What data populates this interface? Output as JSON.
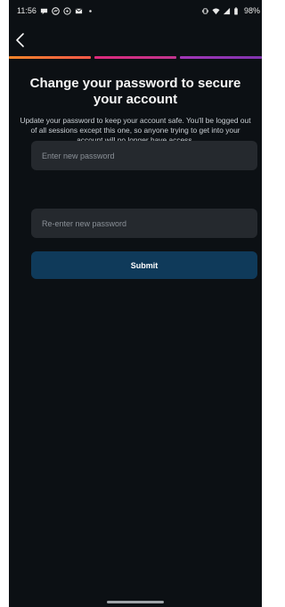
{
  "status_bar": {
    "time": "11:56",
    "battery": "98%",
    "left_icons": [
      "chat-bubble-icon",
      "messenger-icon",
      "whatsapp-icon",
      "gmail-icon",
      "dot-icon"
    ],
    "right_icons": [
      "vibrate-icon",
      "wifi-icon",
      "signal-icon",
      "battery-icon"
    ]
  },
  "nav": {
    "back_icon": "chevron-left-icon"
  },
  "progress": {
    "segments": 3,
    "colors": [
      "#f58529",
      "#dd2a7b",
      "#8134af"
    ]
  },
  "header": {
    "title": "Change your password to secure your account",
    "description": "Update your password to keep your account safe. You'll be logged out of all sessions except this one, so anyone trying to get into your account will no longer have access."
  },
  "form": {
    "new_password": {
      "placeholder": "Enter new password",
      "value": ""
    },
    "reenter_password": {
      "placeholder": "Re-enter new password",
      "value": ""
    },
    "submit_label": "Submit"
  },
  "theme": {
    "background": "#0c1014",
    "input_background": "#25292e",
    "button_background": "#0f3a5a"
  }
}
